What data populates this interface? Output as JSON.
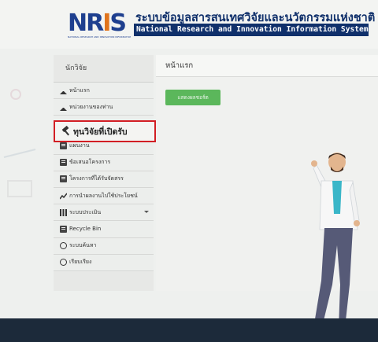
{
  "header": {
    "logo_text": [
      "NR",
      "I",
      "S"
    ],
    "logo_subtext": "NATIONAL RESEARCH AND INNOVATION INFORMATION SYSTEM",
    "title_th": "ระบบข้อมูลสารสนเทศวิจัยและนวัตกรรมแห่งชาติ",
    "title_en": "National Research and Innovation Information System"
  },
  "sidebar": {
    "heading": "นักวิจัย",
    "items": [
      {
        "label": "หน้าแรก",
        "icon": "home-icon"
      },
      {
        "label": "หน่วยงานของท่าน",
        "icon": "home-icon"
      },
      {
        "label": "ทุนวิจัยที่เปิดรับ",
        "icon": "hammer-icon",
        "highlighted": true
      },
      {
        "label": "แผนงาน",
        "icon": "document-icon"
      },
      {
        "label": "ข้อเสนอโครงการ",
        "icon": "document-icon"
      },
      {
        "label": "โครงการที่ได้รับจัดสรร",
        "icon": "document-icon"
      },
      {
        "label": "การนำผลงานไปใช้ประโยชน์",
        "icon": "trend-icon"
      },
      {
        "label": "ระบบประเมิน",
        "icon": "bar-chart-icon",
        "has_dropdown": true
      },
      {
        "label": "Recycle Bin",
        "icon": "document-icon"
      },
      {
        "label": "ระบบค้นหา",
        "icon": "search-icon"
      },
      {
        "label": "เรียบเรียง",
        "icon": "globe-icon"
      }
    ]
  },
  "main": {
    "page_title": "หน้าแรก",
    "action_button": "แสดงผลชอร์ต"
  },
  "colors": {
    "brand_navy": "#10306b",
    "highlight_red": "#d21e24",
    "button_green": "#5bb75b",
    "footer": "#1c2a3a"
  }
}
